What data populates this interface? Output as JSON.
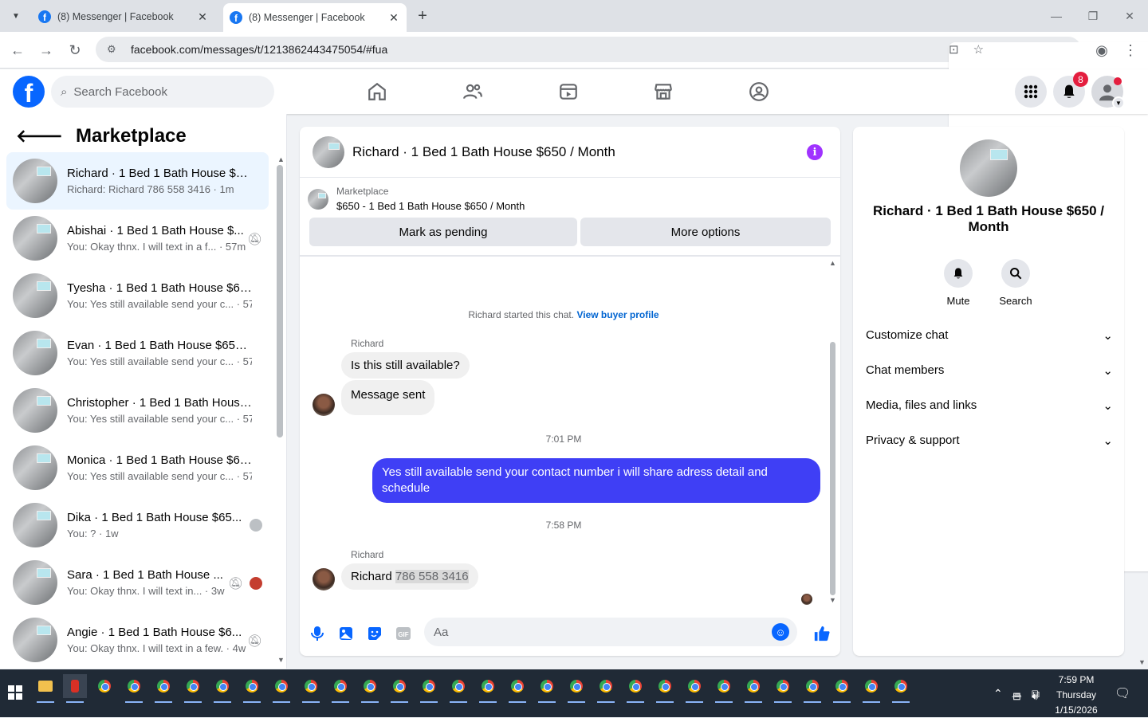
{
  "browser": {
    "tabs": [
      {
        "title": "(8) Messenger | Facebook"
      },
      {
        "title": "(8) Messenger | Facebook"
      }
    ],
    "url": "facebook.com/messages/t/1213862443475054/#fua"
  },
  "fb": {
    "search_placeholder": "Search Facebook",
    "notif_count": "8"
  },
  "left": {
    "title": "Marketplace",
    "conversations": [
      {
        "name": "Richard · 1 Bed 1 Bath House $6...",
        "preview": "Richard: Richard 786 558 3416 · 1m"
      },
      {
        "name": "Abishai · 1 Bed 1 Bath House $...",
        "preview": "You: Okay thnx. I will text in a f... · 57m"
      },
      {
        "name": "Tyesha · 1 Bed 1 Bath House $65...",
        "preview": "You: Yes still available send your c... · 57m"
      },
      {
        "name": "Evan · 1 Bed 1 Bath House $650 /...",
        "preview": "You: Yes still available send your c... · 57m"
      },
      {
        "name": "Christopher · 1 Bed 1 Bath House...",
        "preview": "You: Yes still available send your c... · 57m"
      },
      {
        "name": "Monica · 1 Bed 1 Bath House $65...",
        "preview": "You: Yes still available send your c... · 57m"
      },
      {
        "name": "Dika · 1 Bed 1 Bath House $65...",
        "preview": "You: ? · 1w"
      },
      {
        "name": "Sara · 1 Bed 1 Bath House ...",
        "preview": "You: Okay thnx. I will text in... · 3w"
      },
      {
        "name": "Angie · 1 Bed 1 Bath House $6...",
        "preview": "You: Okay thnx. I will text in a few. · 4w"
      }
    ]
  },
  "chat": {
    "title": "Richard · 1 Bed 1 Bath House $650 / Month",
    "marketplace_label": "Marketplace",
    "listing": "$650 - 1 Bed 1 Bath House $650 / Month",
    "mark_pending": "Mark as pending",
    "more_options": "More options",
    "started_text": "Richard started this chat.",
    "view_buyer": "View buyer profile",
    "sender1": "Richard",
    "msg1": "Is this still available?",
    "msg2": "Message sent",
    "time1": "7:01 PM",
    "out1": "Yes still available send your contact number i will share adress detail and schedule",
    "time2": "7:58 PM",
    "sender2": "Richard",
    "msg3_prefix": "Richard ",
    "msg3_phone": "786 558 3416",
    "input_placeholder": "Aa"
  },
  "info": {
    "name": "Richard · 1 Bed 1 Bath House $650 / Month",
    "mute": "Mute",
    "search": "Search",
    "sections": [
      "Customize chat",
      "Chat members",
      "Media, files and links",
      "Privacy & support"
    ]
  },
  "taskbar": {
    "time": "7:59 PM",
    "day": "Thursday",
    "date": "1/15/2026"
  },
  "colors": {
    "accent": "#0866ff",
    "outgoing_bubble": "#3f3ff5",
    "info_icon": "#a033ff"
  }
}
